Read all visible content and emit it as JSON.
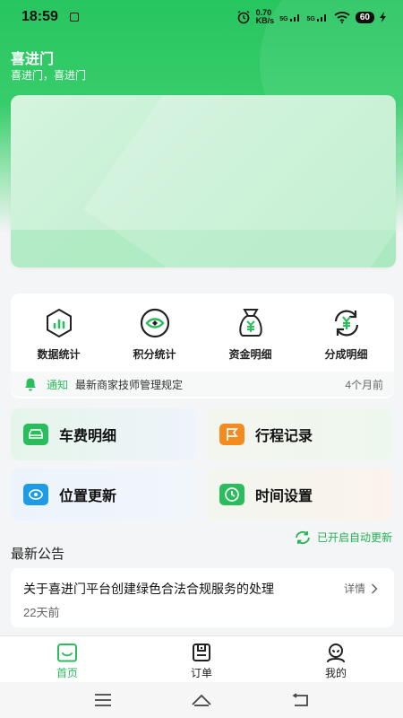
{
  "status_bar": {
    "time": "18:59",
    "network_speed_value": "0.70",
    "network_speed_unit": "KB/s",
    "signal1": "5G",
    "signal2": "5G",
    "battery": "60"
  },
  "header": {
    "title": "喜进门",
    "subtitle": "喜进门，喜进门"
  },
  "menu": [
    {
      "label": "数据统计",
      "icon": "bar-chart-hexagon-icon"
    },
    {
      "label": "积分统计",
      "icon": "eye-icon"
    },
    {
      "label": "资金明细",
      "icon": "money-bag-icon"
    },
    {
      "label": "分成明细",
      "icon": "yuan-refresh-icon"
    }
  ],
  "notice": {
    "tag": "通知",
    "text": "最新商家技师管理规定",
    "time": "4个月前"
  },
  "tiles": [
    {
      "label": "车费明细",
      "icon": "car-icon",
      "color": "#2bbd5d"
    },
    {
      "label": "行程记录",
      "icon": "flag-icon",
      "color": "#f58a1f"
    },
    {
      "label": "位置更新",
      "icon": "location-eye-icon",
      "color": "#1e9be6"
    },
    {
      "label": "时间设置",
      "icon": "clock-icon",
      "color": "#2bbd5d"
    }
  ],
  "auto_update": "已开启自动更新",
  "announcements": {
    "title": "最新公告",
    "items": [
      {
        "title": "关于喜进门平台创建绿色合法合规服务的处理",
        "detail": "详情",
        "time": "22天前"
      }
    ]
  },
  "tabs": [
    {
      "label": "首页",
      "icon": "home-icon",
      "active": true
    },
    {
      "label": "订单",
      "icon": "order-icon",
      "active": false
    },
    {
      "label": "我的",
      "icon": "profile-icon",
      "active": false
    }
  ],
  "colors": {
    "accent": "#2bbd5d",
    "header_green": "#27c55f"
  }
}
